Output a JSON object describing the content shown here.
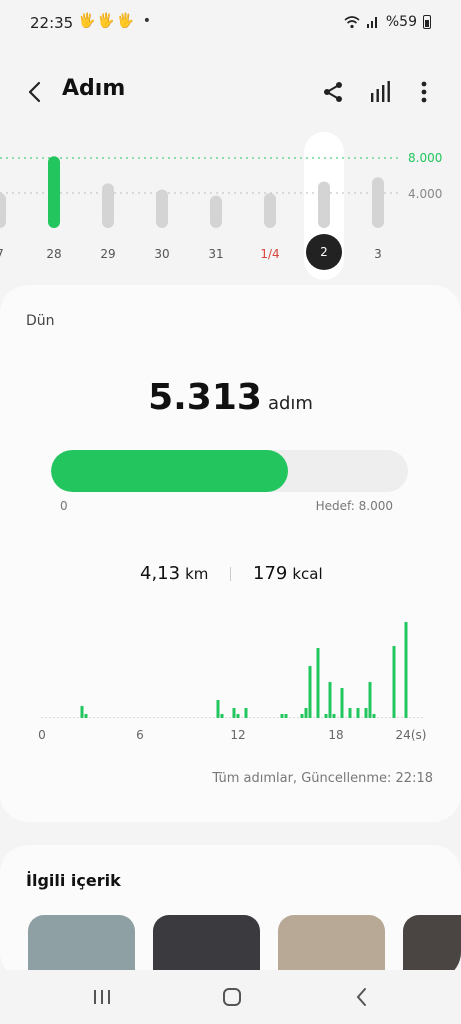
{
  "status": {
    "time": "22:35",
    "notif_icons": "🖐🖐🖐 •",
    "battery": "%59"
  },
  "header": {
    "title": "Adım"
  },
  "week": {
    "goal_high": "8.000",
    "goal_low": "4.000",
    "days": [
      {
        "label": "7",
        "steps": 4000,
        "red": false,
        "selected": false
      },
      {
        "label": "28",
        "steps": 8200,
        "red": false,
        "selected": false
      },
      {
        "label": "29",
        "steps": 5100,
        "red": false,
        "selected": false
      },
      {
        "label": "30",
        "steps": 4400,
        "red": false,
        "selected": false
      },
      {
        "label": "31",
        "steps": 3700,
        "red": false,
        "selected": false
      },
      {
        "label": "1/4",
        "steps": 4000,
        "red": true,
        "selected": false
      },
      {
        "label": "2",
        "steps": 5313,
        "red": false,
        "selected": true
      },
      {
        "label": "3",
        "steps": 5800,
        "red": false,
        "selected": false
      }
    ]
  },
  "summary": {
    "day": "Dün",
    "steps": "5.313",
    "unit": "adım",
    "progress": 0.664,
    "min_label": "0",
    "goal_label": "Hedef: 8.000",
    "distance": "4,13",
    "distance_unit": "km",
    "calories": "179",
    "calories_unit": "kcal",
    "updated": "Tüm adımlar, Güncellenme: 22:18"
  },
  "chart_data": {
    "type": "bar",
    "x_ticks": [
      "0",
      "6",
      "12",
      "18",
      "24(s)"
    ],
    "values": [
      0,
      0,
      0,
      0,
      0,
      0,
      0,
      0,
      0,
      0,
      12,
      4,
      0,
      0,
      0,
      0,
      0,
      0,
      0,
      0,
      0,
      0,
      0,
      0,
      0,
      0,
      0,
      0,
      0,
      0,
      0,
      0,
      0,
      0,
      0,
      0,
      0,
      0,
      0,
      0,
      0,
      0,
      0,
      0,
      18,
      4,
      0,
      0,
      10,
      4,
      0,
      10,
      0,
      0,
      0,
      0,
      0,
      0,
      0,
      0,
      4,
      4,
      0,
      0,
      0,
      4,
      10,
      52,
      0,
      70,
      0,
      4,
      36,
      4,
      0,
      30,
      0,
      10,
      0,
      10,
      0,
      10,
      36,
      4,
      0,
      0,
      0,
      0,
      72,
      0,
      0,
      96,
      0,
      0,
      0,
      0
    ]
  },
  "related": {
    "title": "İlgili içerik",
    "thumb_colors": [
      "#8fa0a4",
      "#3b3b3f",
      "#b8a896",
      "#4a4442"
    ]
  },
  "colors": {
    "accent": "#22c55e",
    "selected_day": "#222222",
    "weekend": "#d9463d"
  }
}
